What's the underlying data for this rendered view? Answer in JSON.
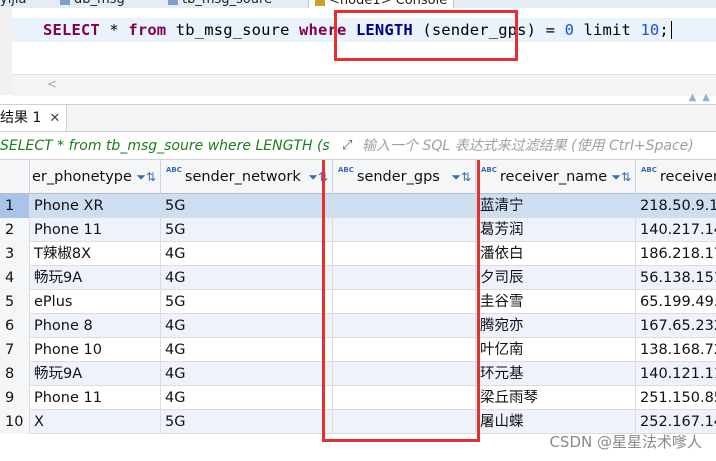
{
  "editor_tabs": [
    {
      "label": "yijia"
    },
    {
      "label": "db_msg"
    },
    {
      "label": "tb_msg_soure"
    },
    {
      "label": "<node1> Console"
    }
  ],
  "editor": {
    "sql_tokens": [
      {
        "text": "SELECT",
        "cls": "kw"
      },
      {
        "text": " * ",
        "cls": ""
      },
      {
        "text": "from",
        "cls": "kw"
      },
      {
        "text": " tb_msg_soure ",
        "cls": ""
      },
      {
        "text": "where",
        "cls": "kw"
      },
      {
        "text": " ",
        "cls": ""
      },
      {
        "text": "LENGTH",
        "cls": "kw2"
      },
      {
        "text": " (sender_gps) = ",
        "cls": ""
      },
      {
        "text": "0",
        "cls": "num"
      },
      {
        "text": " limit ",
        "cls": ""
      },
      {
        "text": "10",
        "cls": "num"
      },
      {
        "text": ";",
        "cls": ""
      }
    ],
    "scroll_left_glyph": "<"
  },
  "result_tab": {
    "label": "结果 1",
    "close": "✕"
  },
  "filter_bar": {
    "query": "SELECT * from tb_msg_soure where LENGTH (s",
    "icon": "filter-expand-icon",
    "placeholder": "输入一个 SQL 表达式来过滤结果 (使用 Ctrl+Space)"
  },
  "grid": {
    "columns": [
      {
        "name": "er_phonetype",
        "type_badge": ""
      },
      {
        "name": "sender_network",
        "type_badge": "ABC"
      },
      {
        "name": "sender_gps",
        "type_badge": "ABC"
      },
      {
        "name": "receiver_name",
        "type_badge": "ABC"
      },
      {
        "name": "receiver",
        "type_badge": "ABC"
      }
    ],
    "sort_glyph": "⇅",
    "rows": [
      {
        "n": "1",
        "c": [
          "Phone XR",
          "5G",
          "",
          "蓝清宁",
          "218.50.9.1"
        ]
      },
      {
        "n": "2",
        "c": [
          "Phone 11",
          "5G",
          "",
          "葛芳润",
          "140.217.14"
        ]
      },
      {
        "n": "3",
        "c": [
          "T辣椒8X",
          "4G",
          "",
          "潘依白",
          "186.218.17"
        ]
      },
      {
        "n": "4",
        "c": [
          "畅玩9A",
          "4G",
          "",
          "夕司辰",
          "56.138.151"
        ]
      },
      {
        "n": "5",
        "c": [
          "ePlus",
          "5G",
          "",
          "圭谷雪",
          "65.199.49."
        ]
      },
      {
        "n": "6",
        "c": [
          "Phone 8",
          "4G",
          "",
          "腾宛亦",
          "167.65.232"
        ]
      },
      {
        "n": "7",
        "c": [
          "Phone 10",
          "4G",
          "",
          "叶亿南",
          "138.168.72"
        ]
      },
      {
        "n": "8",
        "c": [
          "畅玩9A",
          "4G",
          "",
          "环元基",
          "140.121.11"
        ]
      },
      {
        "n": "9",
        "c": [
          "Phone 11",
          "4G",
          "",
          "梁丘雨琴",
          "251.150.85"
        ]
      },
      {
        "n": "10",
        "c": [
          "X",
          "5G",
          "",
          "屠山蝶",
          "252.167.14"
        ]
      }
    ]
  },
  "colors": {
    "highlight_box": "#e53030",
    "selected_row": "#cdddf2",
    "keyword": "#7f0055"
  },
  "watermark": "CSDN @星星法术嗲人"
}
